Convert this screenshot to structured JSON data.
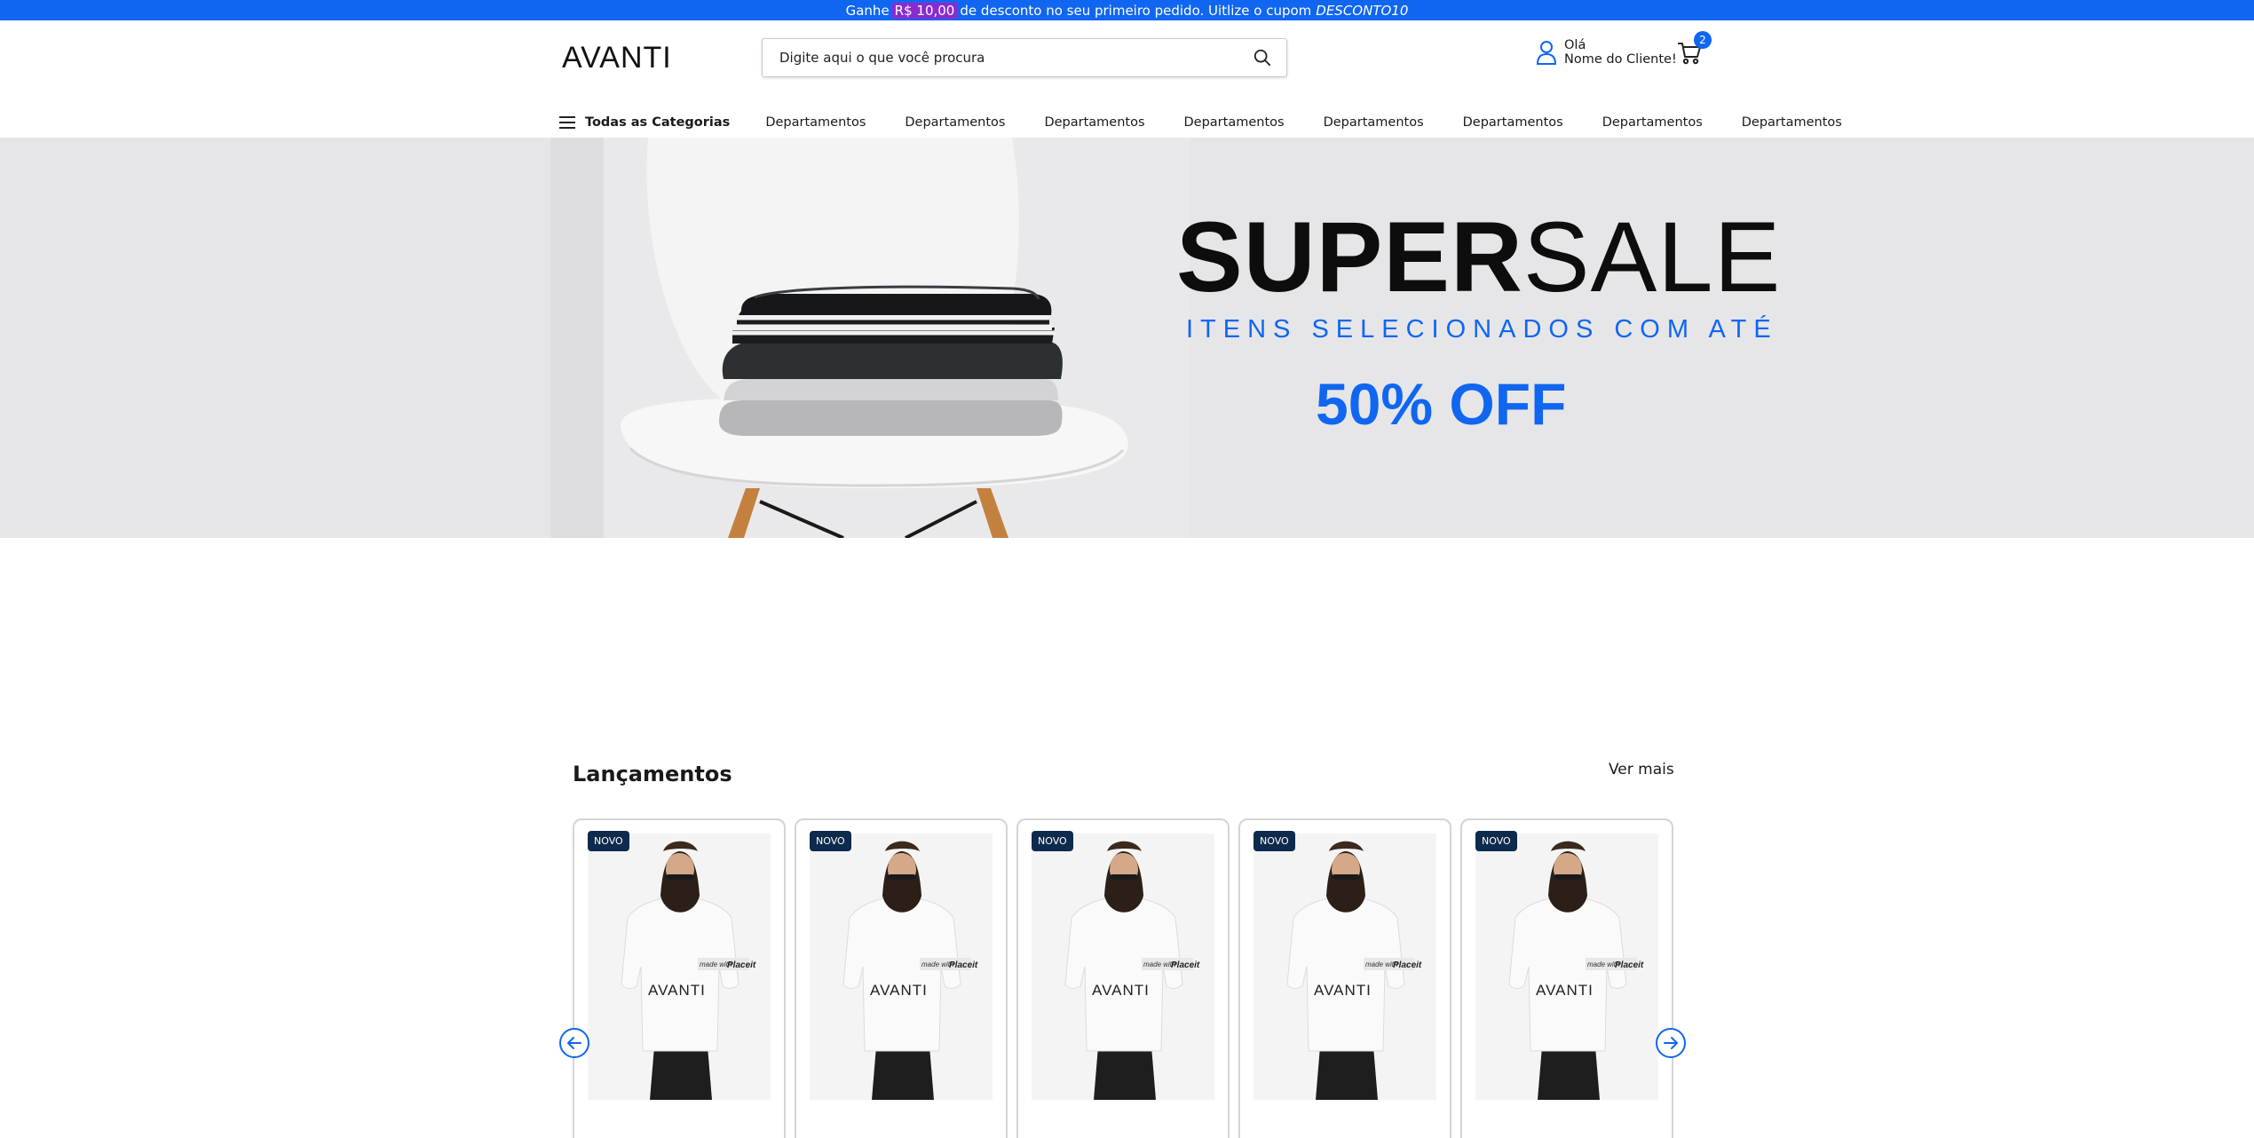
{
  "promo": {
    "prefix": "Ganhe",
    "amount": "R$ 10,00",
    "middle": "de desconto no seu primeiro pedido. Uitlize o cupom",
    "coupon": "DESCONTO10"
  },
  "header": {
    "logo_text": "AVANTI",
    "search_placeholder": "Digite aqui o que você procura",
    "greeting": "Olá",
    "customer_name": "Nome do Cliente!",
    "cart_count": "2"
  },
  "nav": {
    "all_categories": "Todas as Categorias",
    "items": [
      "Departamentos",
      "Departamentos",
      "Departamentos",
      "Departamentos",
      "Departamentos",
      "Departamentos",
      "Departamentos",
      "Departamentos"
    ]
  },
  "hero": {
    "title_bold": "SUPER",
    "title_light": "SALE",
    "subtitle": "ITENS SELECIONADOS COM ATÉ",
    "discount": "50% OFF"
  },
  "launches": {
    "title": "Lançamentos",
    "see_more": "Ver mais",
    "products": [
      {
        "badge": "NOVO",
        "shirt_brand": "AVANTI"
      },
      {
        "badge": "NOVO",
        "shirt_brand": "AVANTI"
      },
      {
        "badge": "NOVO",
        "shirt_brand": "AVANTI"
      },
      {
        "badge": "NOVO",
        "shirt_brand": "AVANTI"
      },
      {
        "badge": "NOVO",
        "shirt_brand": "AVANTI"
      }
    ]
  },
  "colors": {
    "primary": "#1066f0",
    "badge": "#0e2a4d",
    "highlight": "#8a2bd0"
  }
}
